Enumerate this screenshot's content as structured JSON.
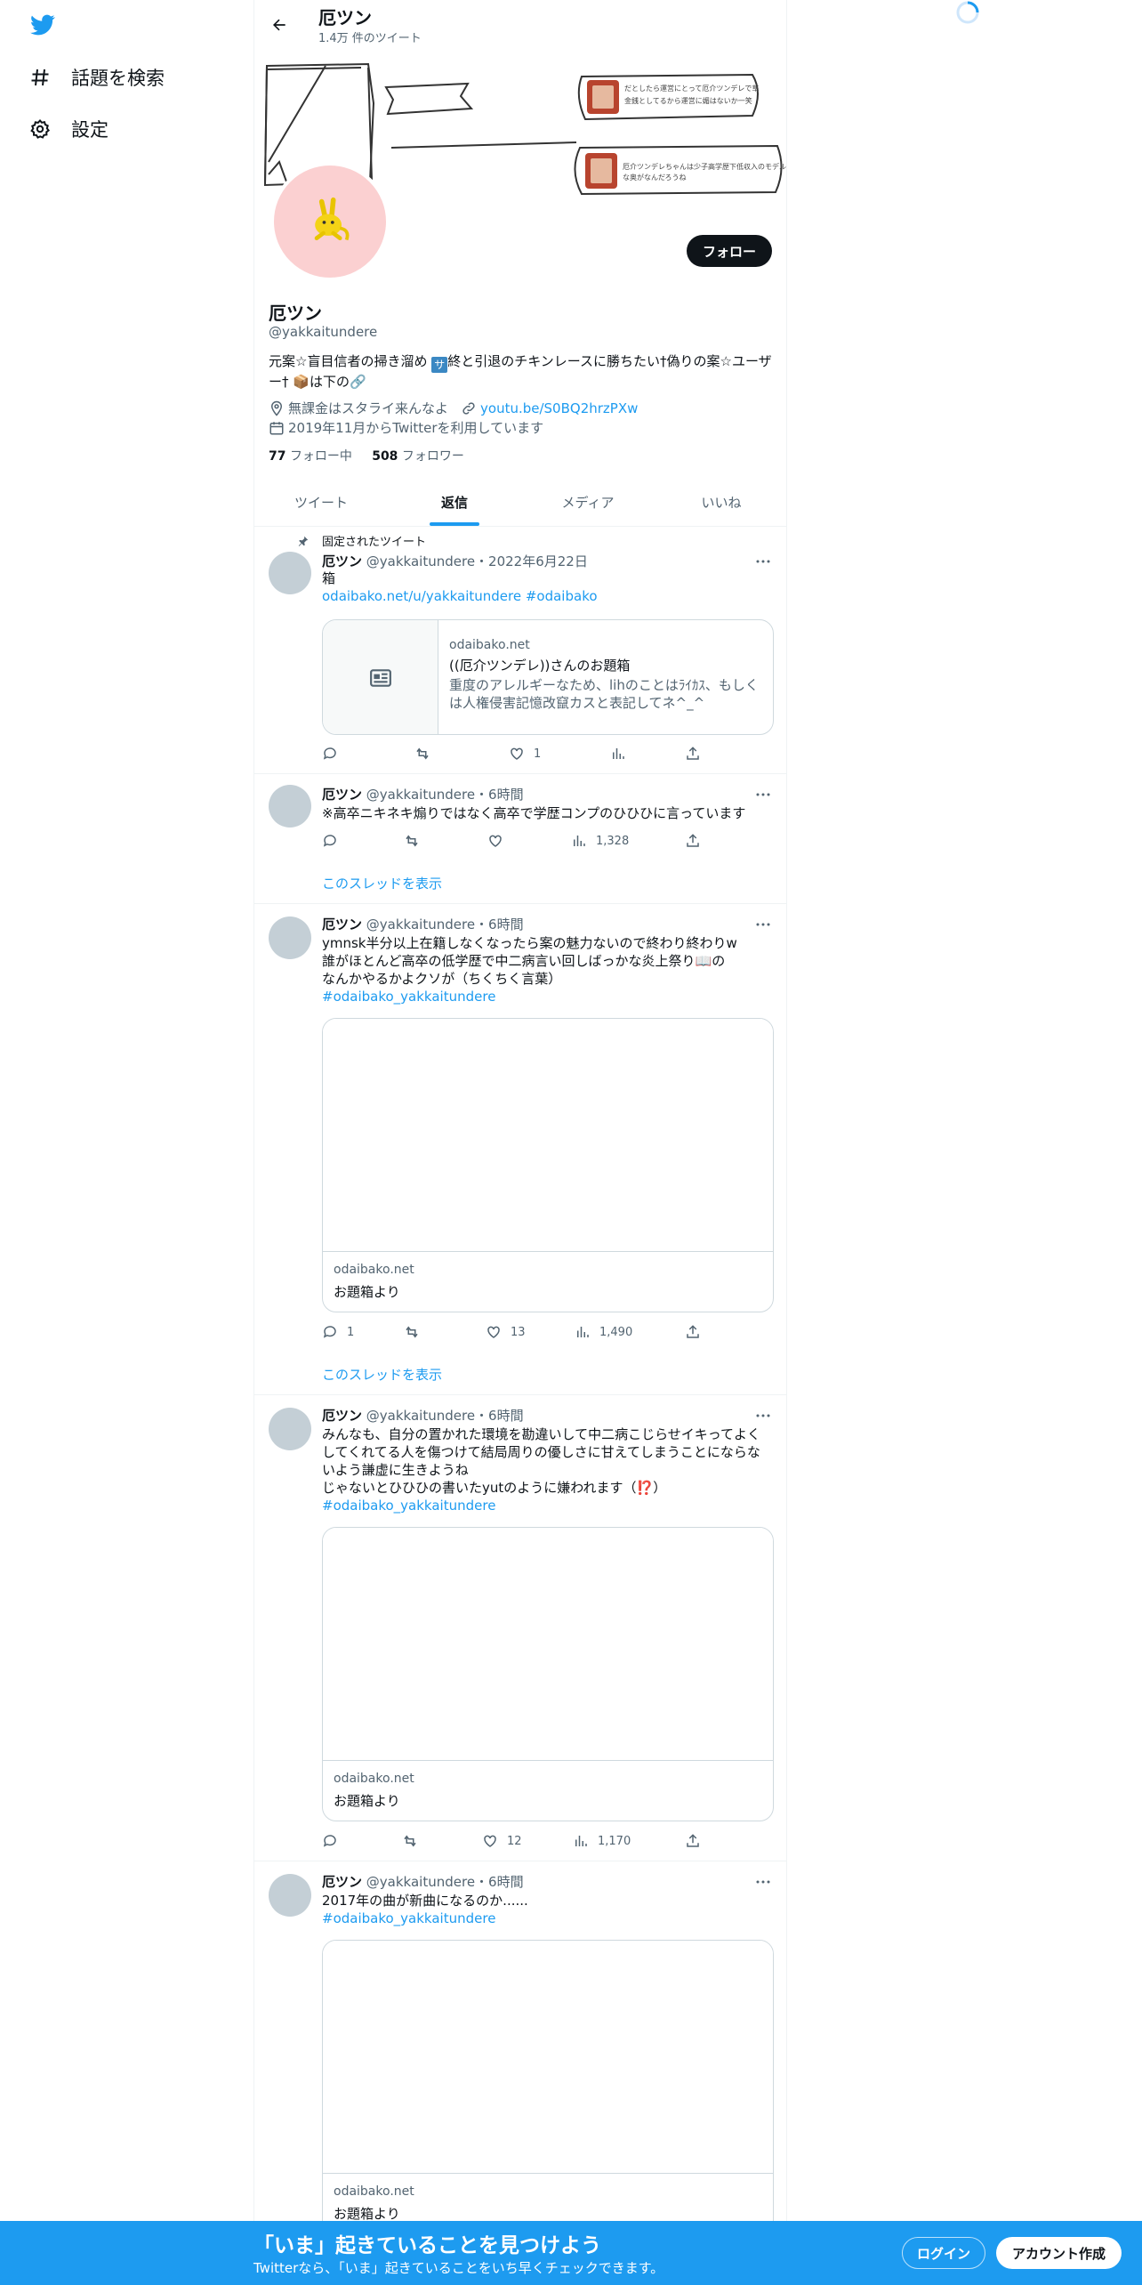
{
  "sidebar": {
    "items": [
      {
        "label": "話題を検索",
        "icon": "hashtag-icon"
      },
      {
        "label": "設定",
        "icon": "gear-icon"
      }
    ]
  },
  "header": {
    "name": "厄ツン",
    "tweet_count": "1.4万 件のツイート"
  },
  "banner": {
    "note_1": "だとしたら運営にとって厄介ツンデレで草 金銭としてるから運営に媚はないか一笑",
    "note_2": "厄介ツンデレちゃんは少子高学歴下低収入のモデルみたいな奥がなんだろうね"
  },
  "profile": {
    "follow_label": "フォロー",
    "name": "厄ツン",
    "handle": "@yakkaitundere",
    "bio_1": "元案☆盲目信者の掃き溜め ",
    "bio_sq": "サ",
    "bio_2": "終と引退のチキンレースに勝ちたい†偽りの案☆ユーザー† 📦は下の🔗",
    "location": "無課金はスタライ来んなよ",
    "link": "youtu.be/S0BQ2hrzPXw",
    "joined": "2019年11月からTwitterを利用しています",
    "following_count": "77",
    "following_label": "フォロー中",
    "followers_count": "508",
    "followers_label": "フォロワー"
  },
  "tabs": [
    {
      "label": "ツイート"
    },
    {
      "label": "返信"
    },
    {
      "label": "メディア"
    },
    {
      "label": "いいね"
    }
  ],
  "pinned_label": "固定されたツイート",
  "tweets": [
    {
      "name": "厄ツン",
      "handle_time": "@yakkaitundere・2022年6月22日",
      "text": "箱",
      "link": "odaibako.net/u/yakkaitundere #odaibako",
      "card_domain": "odaibako.net",
      "card_title": "((厄介ツンデレ))さんのお題箱",
      "card_desc": "重度のアレルギーなため、lihのことはﾗｲｶｽ、もしくは人権侵害記憶改竄カスと表記してネ^_^",
      "reply": "",
      "retweet": "",
      "like": "1",
      "views": ""
    },
    {
      "name": "厄ツン",
      "handle_time": "@yakkaitundere・6時間",
      "text": "※高卒ニキネキ煽りではなく高卒で学歴コンプのひひひに言っています",
      "reply": "",
      "retweet": "",
      "like": "",
      "views": "1,328",
      "thread": "このスレッドを表示"
    },
    {
      "name": "厄ツン",
      "handle_time": "@yakkaitundere・6時間",
      "text_1": "ymnsk半分以上在籍しなくなったら案の魅力ないので終わり終わりw",
      "text_2": "誰がほとんど高卒の低学歴で中二病言い回しばっかな炎上祭り📖の",
      "text_3": "なんかやるかよクソが（ちくちく言葉）",
      "hashtag": "#odaibako_yakkaitundere",
      "card_domain": "odaibako.net",
      "card_title": "お題箱より",
      "reply": "1",
      "retweet": "",
      "like": "13",
      "views": "1,490",
      "thread": "このスレッドを表示"
    },
    {
      "name": "厄ツン",
      "handle_time": "@yakkaitundere・6時間",
      "text_1": "みんなも、自分の置かれた環境を勘違いして中二病こじらせイキってよく",
      "text_2": "してくれてる人を傷つけて結局周りの優しさに甘えてしまうことにならな",
      "text_3": "いよう謙虚に生きようね",
      "text_4": "じゃないとひひひの書いたyutのように嫌われます（⁉️）",
      "hashtag": "#odaibako_yakkaitundere",
      "card_domain": "odaibako.net",
      "card_title": "お題箱より",
      "reply": "",
      "retweet": "",
      "like": "12",
      "views": "1,170"
    },
    {
      "name": "厄ツン",
      "handle_time": "@yakkaitundere・6時間",
      "text": "2017年の曲が新曲になるのか......",
      "hashtag": "#odaibako_yakkaitundere",
      "card_domain": "odaibako.net",
      "card_title": "お題箱より"
    }
  ],
  "bottom_bar": {
    "title": "「いま」起きていることを見つけよう",
    "subtitle": "Twitterなら、「いま」起きていることをいち早くチェックできます。",
    "login": "ログイン",
    "signup": "アカウント作成"
  },
  "colors": {
    "accent": "#1d9bf0",
    "text": "#0f1419",
    "secondary": "#536471",
    "avatar_bg": "#fbd0d1"
  }
}
